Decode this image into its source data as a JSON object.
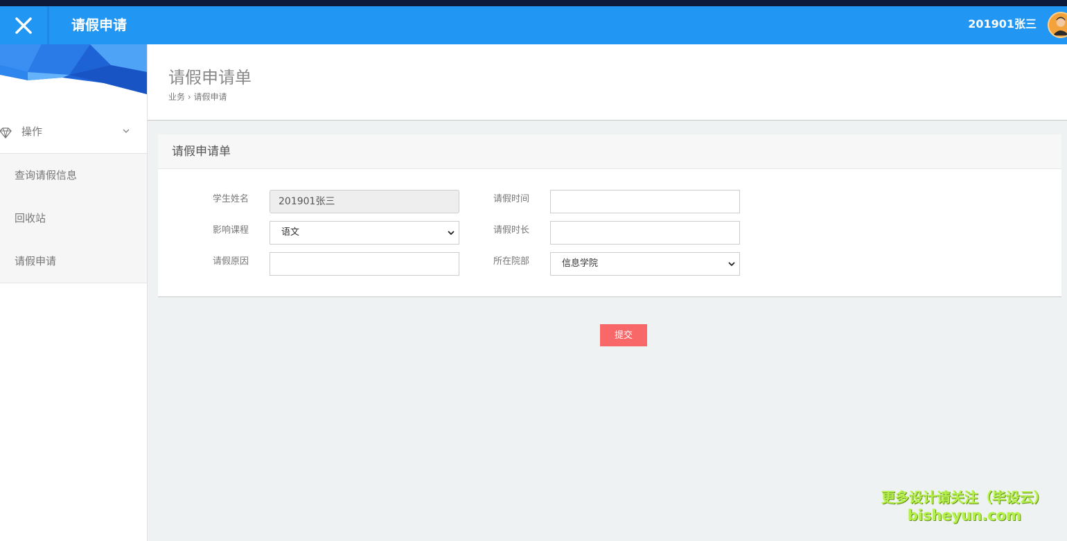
{
  "colors": {
    "header_bg": "#2196f3",
    "top_strip": "#0e1a3c",
    "submit_bg": "#f96868",
    "page_bg": "#eff2f3",
    "watermark": "#b4f04c"
  },
  "header": {
    "close_icon": "close-icon",
    "title": "请假申请",
    "user": "201901张三",
    "avatar_icon": "avatar"
  },
  "sidebar": {
    "group": {
      "icon": "diamond-icon",
      "label": "操作",
      "chevron": "chevron-down-icon"
    },
    "items": [
      {
        "label": "查询请假信息"
      },
      {
        "label": "回收站"
      },
      {
        "label": "请假申请"
      }
    ]
  },
  "page": {
    "title": "请假申请单",
    "breadcrumb": {
      "parent": "业务",
      "separator": "›",
      "current": "请假申请"
    }
  },
  "form": {
    "card_title": "请假申请单",
    "fields": {
      "student_name": {
        "label": "学生姓名",
        "value": "201901张三"
      },
      "leave_time": {
        "label": "请假时间",
        "value": ""
      },
      "course": {
        "label": "影响课程",
        "selected": "语文"
      },
      "duration": {
        "label": "请假时长",
        "value": ""
      },
      "reason": {
        "label": "请假原因",
        "value": ""
      },
      "department": {
        "label": "所在院部",
        "selected": "信息学院"
      }
    },
    "submit_label": "提交"
  },
  "watermark": {
    "line1": "更多设计请关注（毕设云）",
    "line2": "bisheyun.com"
  }
}
